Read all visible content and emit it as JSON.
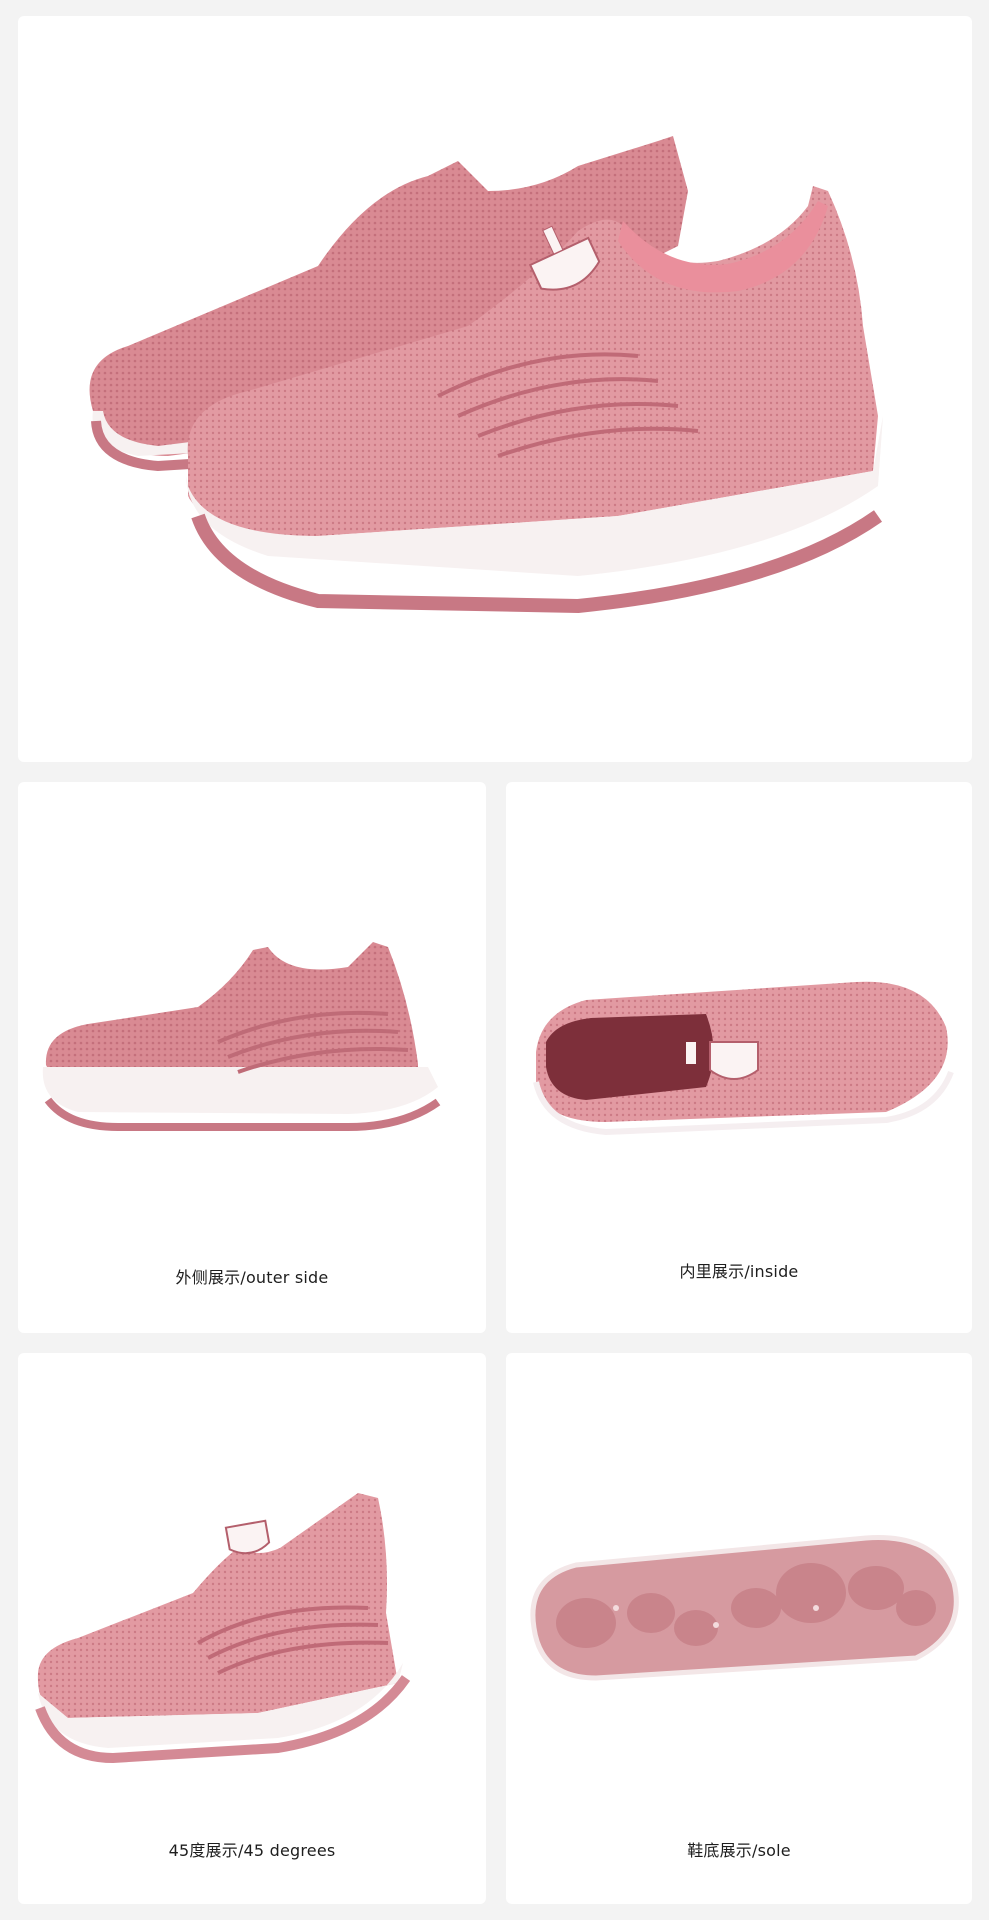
{
  "colors": {
    "background": "#f3f3f3",
    "card": "#ffffff",
    "shoe_pink": "#d9848e",
    "shoe_pink_dark": "#b55f6b",
    "shoe_pink_light": "#e8a7ae",
    "sole_white": "#f7f1f1",
    "outsole_pink": "#c87884"
  },
  "hero": {
    "image_icon": "pink-knit-slip-on-shoes-pair-image"
  },
  "tiles": [
    {
      "caption": "外侧展示/outer side",
      "image_icon": "shoe-outer-side-image"
    },
    {
      "caption": "内里展示/inside",
      "image_icon": "shoe-inside-view-image"
    },
    {
      "caption": "45度展示/45 degrees",
      "image_icon": "shoe-45-degree-image"
    },
    {
      "caption": "鞋底展示/sole",
      "image_icon": "shoe-sole-image"
    }
  ]
}
